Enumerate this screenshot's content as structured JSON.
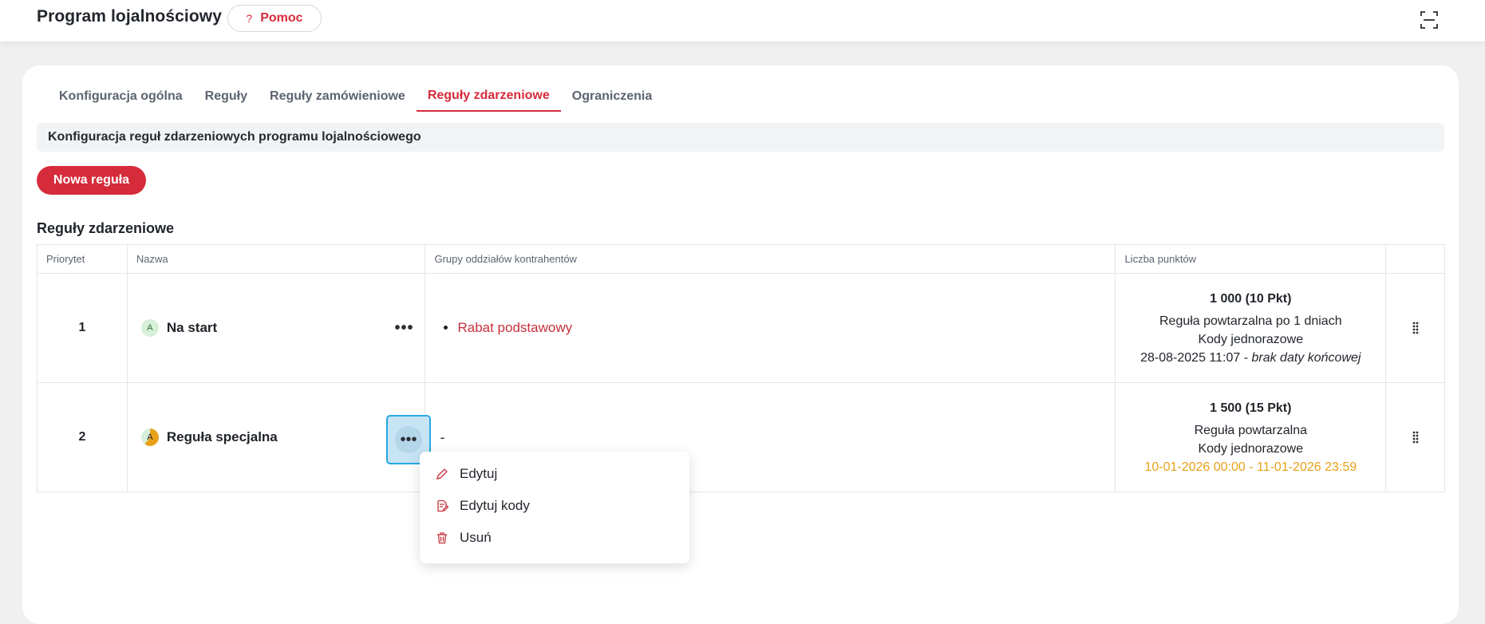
{
  "header": {
    "title": "Program lojalnościowy",
    "help_label": "Pomoc",
    "help_icon_glyph": "?"
  },
  "tabs": [
    {
      "label": "Konfiguracja ogólna",
      "active": false
    },
    {
      "label": "Reguły",
      "active": false
    },
    {
      "label": "Reguły zamówieniowe",
      "active": false
    },
    {
      "label": "Reguły zdarzeniowe",
      "active": true
    },
    {
      "label": "Ograniczenia",
      "active": false
    }
  ],
  "info_text": "Konfiguracja reguł zdarzeniowych programu lojalnościowego",
  "new_rule_label": "Nowa reguła",
  "section_title": "Reguły zdarzeniowe",
  "table": {
    "columns": [
      "Priorytet",
      "Nazwa",
      "Grupy oddziałów kontrahentów",
      "Liczba punktów",
      ""
    ],
    "rows": [
      {
        "priority": "1",
        "avatar": "A",
        "name": "Na start",
        "groups": [
          "Rabat podstawowy"
        ],
        "points": "1 000 (10 Pkt)",
        "repeat": "Reguła powtarzalna po 1 dniach",
        "codes": "Kody jednorazowe",
        "date_start": "28-08-2025 11:07",
        "date_sep": " - ",
        "date_end": "brak daty końcowej"
      },
      {
        "priority": "2",
        "avatar": "A",
        "name": "Reguła specjalna",
        "groups_empty": "-",
        "points": "1 500 (15 Pkt)",
        "repeat": "Reguła powtarzalna",
        "codes": "Kody jednorazowe",
        "date_range": "10-01-2026 00:00 - 11-01-2026 23:59"
      }
    ]
  },
  "kebab_glyph": "•••",
  "context_menu": {
    "items": [
      {
        "label": "Edytuj",
        "icon": "pencil-icon"
      },
      {
        "label": "Edytuj kody",
        "icon": "edit-document-icon"
      },
      {
        "label": "Usuń",
        "icon": "trash-icon"
      }
    ]
  },
  "colors": {
    "accent": "#d62b3a",
    "warning": "#e8a21a",
    "focus": "#29a8e0"
  }
}
